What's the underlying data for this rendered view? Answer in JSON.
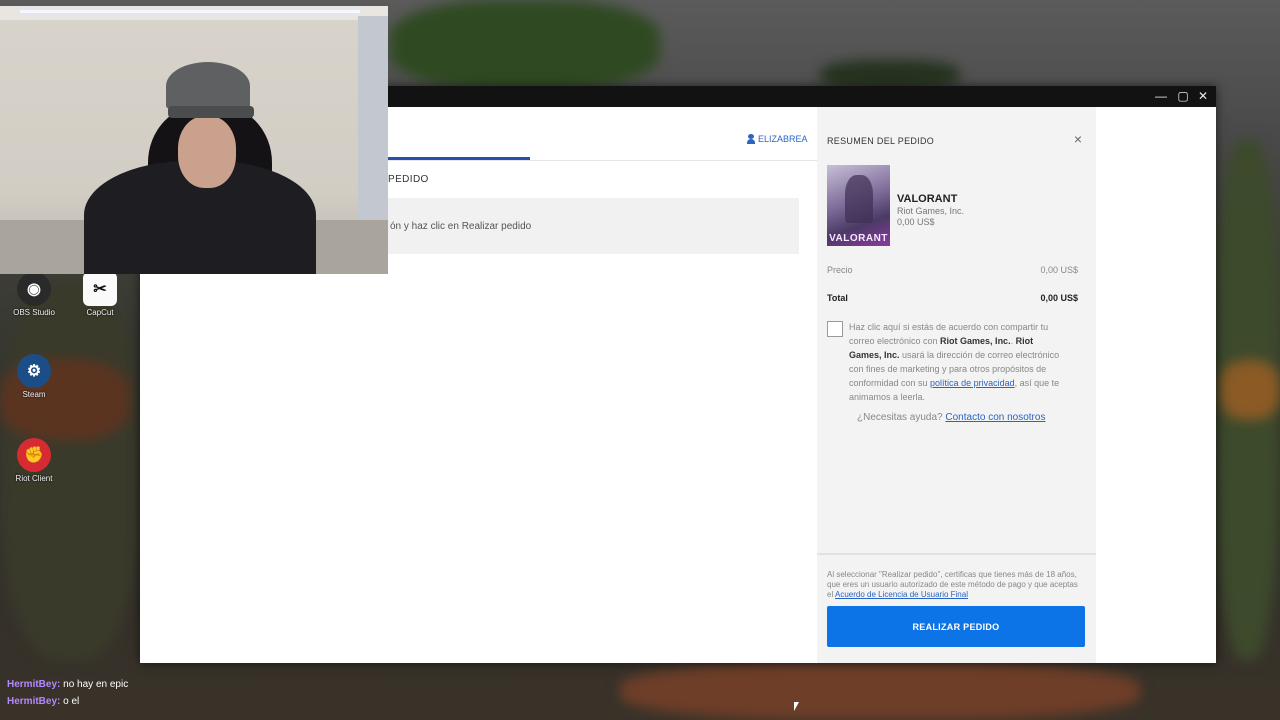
{
  "window": {
    "controls": {
      "minimize": "—",
      "maximize": "▢",
      "close": "✕"
    }
  },
  "checkout": {
    "account_label": "ELIZABREA",
    "section_title": "PEDIDO",
    "info_text": "ón y haz clic en Realizar pedido"
  },
  "summary": {
    "title": "RESUMEN DEL PEDIDO",
    "close": "×",
    "product": {
      "cover_logo": "VALORANT",
      "name": "VALORANT",
      "developer": "Riot Games, Inc.",
      "price": "0,00 US$"
    },
    "price_label": "Precio",
    "price_value": "0,00 US$",
    "total_label": "Total",
    "total_value": "0,00 US$",
    "consent": {
      "part1": "Haz clic aquí si estás de acuerdo con compartir tu correo electrónico con ",
      "company1": "Riot Games, Inc.",
      "sep": ". ",
      "company2": "Riot Games, Inc.",
      "part2": " usará la dirección de correo electrónico con fines de marketing y para otros propósitos de conformidad con su ",
      "privacy_link": "política de privacidad",
      "part3": ", así que te animamos a leerla."
    },
    "help_text": "¿Necesitas ayuda?",
    "help_link": "Contacto con nosotros",
    "legal": {
      "text": "Al seleccionar \"Realizar pedido\", certificas que tienes más de 18 años, que eres un usuario autorizado de este método de pago y que aceptas el ",
      "link": "Acuerdo de Licencia de Usuario Final"
    },
    "place_order_label": "REALIZAR PEDIDO"
  },
  "desktop": {
    "icons": [
      {
        "name": "OBS Studio",
        "glyph": "◉"
      },
      {
        "name": "CapCut",
        "glyph": "✂"
      },
      {
        "name": "Steam",
        "glyph": "⚙"
      },
      {
        "name": "Riot Client",
        "glyph": "✊"
      }
    ]
  },
  "chat": [
    {
      "user": "HermitBey:",
      "message": "no hay en epic"
    },
    {
      "user": "HermitBey:",
      "message": "o el"
    }
  ]
}
